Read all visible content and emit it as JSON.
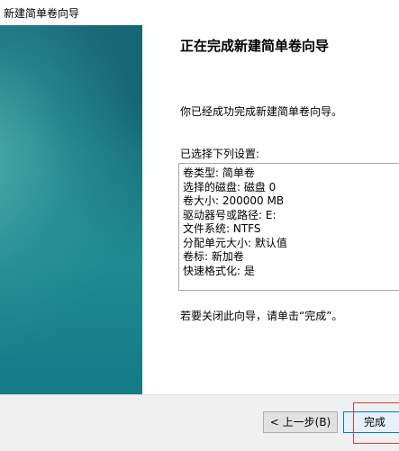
{
  "window": {
    "title": "新建简单卷向导"
  },
  "page": {
    "title": "正在完成新建简单卷向导",
    "intro": "你已经成功完成新建简单卷向导。",
    "settings_label": "已选择下列设置:",
    "settings": [
      "卷类型: 简单卷",
      "选择的磁盘: 磁盘 0",
      "卷大小: 200000 MB",
      "驱动器号或路径: E:",
      "文件系统: NTFS",
      "分配单元大小: 默认值",
      "卷标: 新加卷",
      "快速格式化: 是"
    ],
    "close_hint": "若要关闭此向导，请单击“完成”。"
  },
  "footer": {
    "back_label": "< 上一步(B)",
    "finish_label": "完成"
  },
  "colors": {
    "banner_teal": "#1f8a92",
    "highlight_red": "#e03a3a",
    "focus_blue": "#0078d7"
  }
}
